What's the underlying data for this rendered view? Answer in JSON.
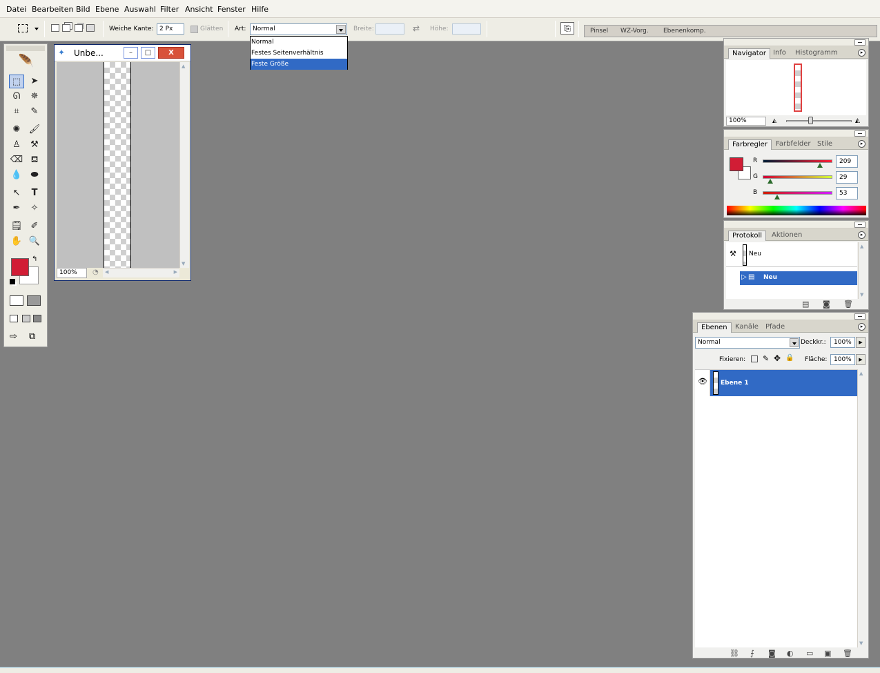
{
  "menubar": {
    "items": [
      "Datei",
      "Bearbeiten",
      "Bild",
      "Ebene",
      "Auswahl",
      "Filter",
      "Ansicht",
      "Fenster",
      "Hilfe"
    ]
  },
  "options": {
    "feather_label": "Weiche Kante:",
    "feather_value": "2 Px",
    "antialias_label": "Glätten",
    "style_label": "Art:",
    "style_value": "Normal",
    "width_label": "Breite:",
    "height_label": "Höhe:",
    "style_options": [
      "Normal",
      "Festes Seitenverhältnis",
      "Feste Größe"
    ],
    "style_highlighted": "Feste Größe"
  },
  "palette_well": {
    "tabs": [
      "Pinsel",
      "WZ-Vorg.",
      "Ebenenkomp."
    ]
  },
  "document": {
    "title": "Unbe...",
    "zoom": "100%",
    "min_label": "–",
    "max_label": "□",
    "close_label": "X"
  },
  "navigator": {
    "tabs": [
      "Navigator",
      "Info",
      "Histogramm"
    ],
    "zoom": "100%"
  },
  "color": {
    "tabs": [
      "Farbregler",
      "Farbfelder",
      "Stile"
    ],
    "channels": [
      {
        "label": "R",
        "value": "209"
      },
      {
        "label": "G",
        "value": "29"
      },
      {
        "label": "B",
        "value": "53"
      }
    ],
    "foreground": "#d11d35",
    "slider_levels": {
      "r": 0.82,
      "g": 0.11,
      "b": 0.21
    }
  },
  "history": {
    "tabs": [
      "Protokoll",
      "Aktionen"
    ],
    "snapshot_label": "Neu",
    "state_label": "Neu"
  },
  "layers": {
    "tabs": [
      "Ebenen",
      "Kanäle",
      "Pfade"
    ],
    "blend_mode": "Normal",
    "opacity_label": "Deckkr.:",
    "opacity_value": "100%",
    "lock_label": "Fixieren:",
    "fill_label": "Fläche:",
    "fill_value": "100%",
    "layer_name": "Ebene 1"
  },
  "icons": {
    "eye": "👁",
    "menu_arrow": "▸",
    "arrow_right": "▶"
  }
}
